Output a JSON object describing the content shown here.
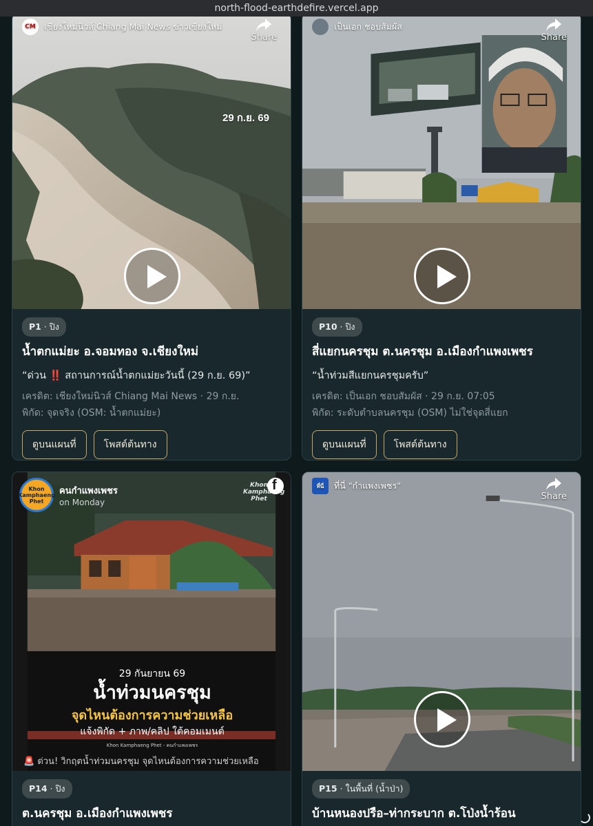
{
  "browser": {
    "url": "north-flood-earthdefire.vercel.app"
  },
  "cards": [
    {
      "embed_author": "เชียงใหม่นิวส์ Chiang Mai News ข่าวเชียงใหม่",
      "share_label": "Share",
      "overlay_date": "29 ก.ย. 69",
      "badge_code": "P1",
      "badge_sep": " · ",
      "badge_area": "ปิง",
      "title": "น้ำตกแม่ยะ อ.จอมทอง จ.เชียงใหม่",
      "quote_open": "“ด่วน ",
      "quote_icon": "‼️",
      "quote_rest": " สถานการณ์น้ำตกแม่ยะวันนี้ (29 ก.ย. 69)”",
      "credit": "เครดิต: เชียงใหม่นิวส์ Chiang Mai News · 29 ก.ย.",
      "coords": "พิกัด: จุดจริง (OSM: น้ำตกแม่ยะ)",
      "btn_map": "ดูบนแผนที่",
      "btn_post": "โพสต์ต้นทาง"
    },
    {
      "embed_author": "เป็นเอก ชอบสัมผัส",
      "share_label": "Share",
      "badge_code": "P10",
      "badge_sep": " · ",
      "badge_area": "ปิง",
      "title": "สี่แยกนครชุม ต.นครชุม อ.เมืองกำแพงเพชร",
      "quote": "“น้ำท่วมสีแยกนครชุมครับ”",
      "credit": "เครดิต: เป็นเอก ชอบสัมผัส · 29 ก.ย. 07:05",
      "coords": "พิกัด: ระดับตำบลนครชุม (OSM) ไม่ใช่จุดสี่แยก",
      "btn_map": "ดูบนแผนที่",
      "btn_post": "โพสต์ต้นทาง"
    },
    {
      "page_name": "คนกำแพงเพชร",
      "page_time": "on Monday",
      "logo_text": "Khon Kamphaeng Phet",
      "watermark": "Khon Kamphaeng Phet",
      "poster_date": "29 กันยายน 69",
      "poster_headline": "น้ำท่วมนครชุม",
      "poster_sub": "จุดไหนต้องการความช่วยเหลือ",
      "poster_cta": "แจ้งพิกัด + ภาพ/คลิป ใต้คอมเมนต์",
      "poster_footer": "Khon Kamphaeng Phet - คนกำแพงเพชร",
      "caption": "🚨 ด่วน! วิกฤตน้ำท่วมนครชุม จุดไหนต้องการความช่วยเหลือ",
      "badge_code": "P14",
      "badge_sep": " · ",
      "badge_area": "ปิง",
      "title": "ต.นครชุม อ.เมืองกำแพงเพชร"
    },
    {
      "embed_author": "ที่นี่ \"กำแพงเพชร\"",
      "avatar_text": "ที่นี่",
      "share_label": "Share",
      "badge_code": "P15",
      "badge_sep": " · ",
      "badge_area": "ในพื้นที่ (น้ำป่า)",
      "title": "บ้านหนองปรือ–ท่ากระบาก ต.โป่งน้ำร้อน"
    }
  ],
  "colors": {
    "page_bg": "#0f1a1d",
    "card_bg": "#18282c",
    "button_border": "#c7a964",
    "badge_bg": "#3f4a4d"
  },
  "icons": [
    "share-icon",
    "play-icon",
    "facebook-icon",
    "loading-spinner-icon"
  ]
}
